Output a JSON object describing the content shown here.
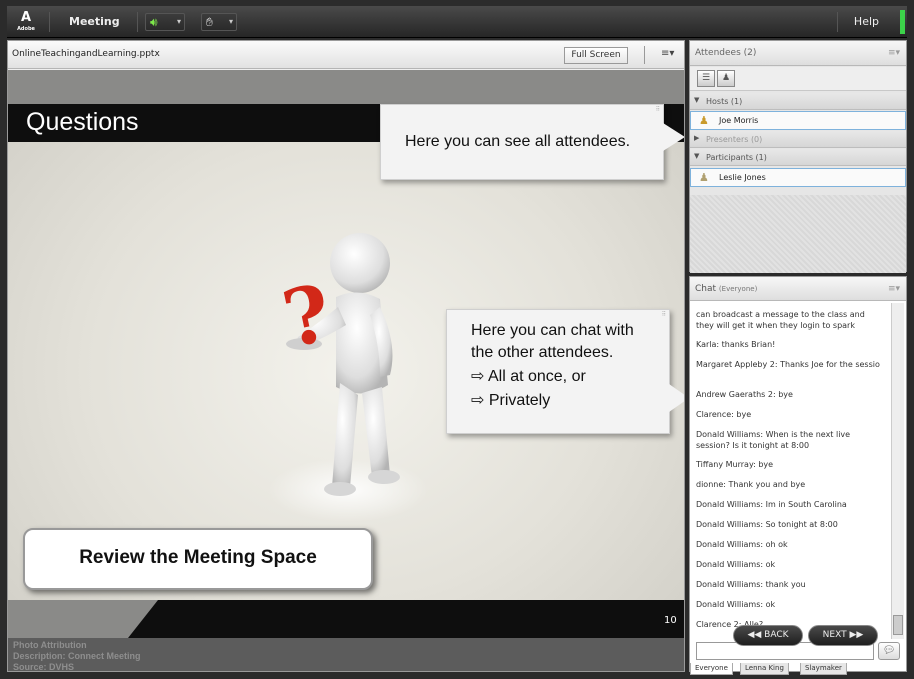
{
  "topbar": {
    "logo_text": "Adobe",
    "menu_meeting": "Meeting",
    "help": "Help",
    "audio_icon": "speaker-icon",
    "status_icon": "raise-hand-icon"
  },
  "share": {
    "file_name": "OnlineTeachingandLearning.pptx",
    "full_screen": "Full Screen",
    "options_glyph": "≡▾"
  },
  "slide": {
    "title": "Questions",
    "callout_attendees": "Here you can see all attendees.",
    "callout_chat": {
      "line1": "Here you can chat with",
      "line2": "the other attendees.",
      "bullet1": "All at once, or",
      "bullet2": "Privately"
    },
    "review_label": "Review the Meeting Space",
    "page_number": "10",
    "attribution": {
      "line1": "Photo Attribution",
      "line2": "Description: Connect Meeting",
      "line3": "Source: DVHS"
    }
  },
  "attendees": {
    "title": "Attendees",
    "count": "(2)",
    "hosts_label": "Hosts (1)",
    "host_name": "Joe Morris",
    "presenters_label": "Presenters (0)",
    "participants_label": "Participants (1)",
    "participant_name": "Leslie Jones"
  },
  "chat": {
    "title": "Chat",
    "scope": "(Everyone)",
    "messages": [
      "can broadcast a message to the class and they will get it when they login to spark",
      "Karla: thanks Brian!",
      "Margaret Appleby 2: Thanks Joe for the sessio",
      "Andrew Gaeraths 2: bye",
      "Clarence: bye",
      "Donald Williams: When is the next live session? Is it tonight at 8:00",
      "Tiffany Murray: bye",
      "dionne: Thank you and bye",
      "Donald Williams: Im in South Carolina",
      "Donald Williams: So tonight at 8:00",
      "Donald Williams: oh ok",
      "Donald Williams: ok",
      "Donald Williams: thank you",
      "Donald Williams: ok",
      "Clarence 2: Alle?"
    ],
    "tabs": [
      "Everyone",
      "Lenna King",
      "Slaymaker"
    ]
  },
  "nav": {
    "back": "◀◀ BACK",
    "next": "NEXT ▶▶"
  }
}
